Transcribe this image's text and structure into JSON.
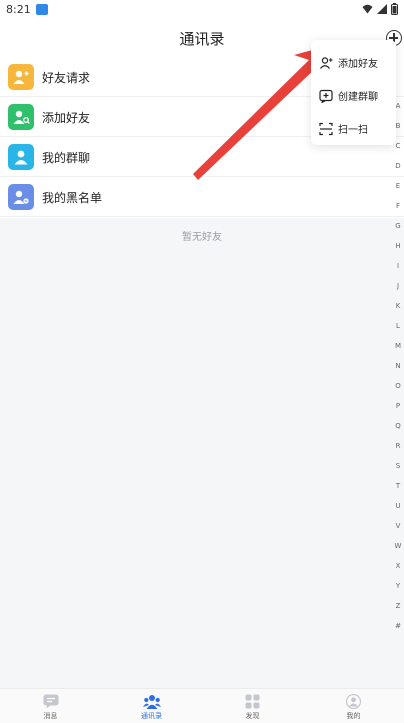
{
  "status_bar": {
    "time": "8:21"
  },
  "header": {
    "title": "通讯录"
  },
  "contacts": {
    "items": [
      {
        "label": "好友请求",
        "color": "#f6b73c"
      },
      {
        "label": "添加好友",
        "color": "#2fc06b"
      },
      {
        "label": "我的群聊",
        "color": "#2ab5e8"
      },
      {
        "label": "我的黑名单",
        "color": "#6a8ee8"
      }
    ],
    "empty_text": "暂无好友"
  },
  "index_letters": [
    "A",
    "B",
    "C",
    "D",
    "E",
    "F",
    "G",
    "H",
    "I",
    "J",
    "K",
    "L",
    "M",
    "N",
    "O",
    "P",
    "Q",
    "R",
    "S",
    "T",
    "U",
    "V",
    "W",
    "X",
    "Y",
    "Z",
    "#"
  ],
  "popup_menu": {
    "items": [
      {
        "label": "添加好友",
        "icon": "add-user-icon"
      },
      {
        "label": "创建群聊",
        "icon": "create-group-icon"
      },
      {
        "label": "扫一扫",
        "icon": "scan-icon"
      }
    ]
  },
  "bottom_nav": {
    "items": [
      {
        "label": "消息"
      },
      {
        "label": "通讯录"
      },
      {
        "label": "发现"
      },
      {
        "label": "我的"
      }
    ],
    "active_color": "#2f6de0"
  },
  "annotation": {
    "arrow_color": "#e8413b"
  }
}
